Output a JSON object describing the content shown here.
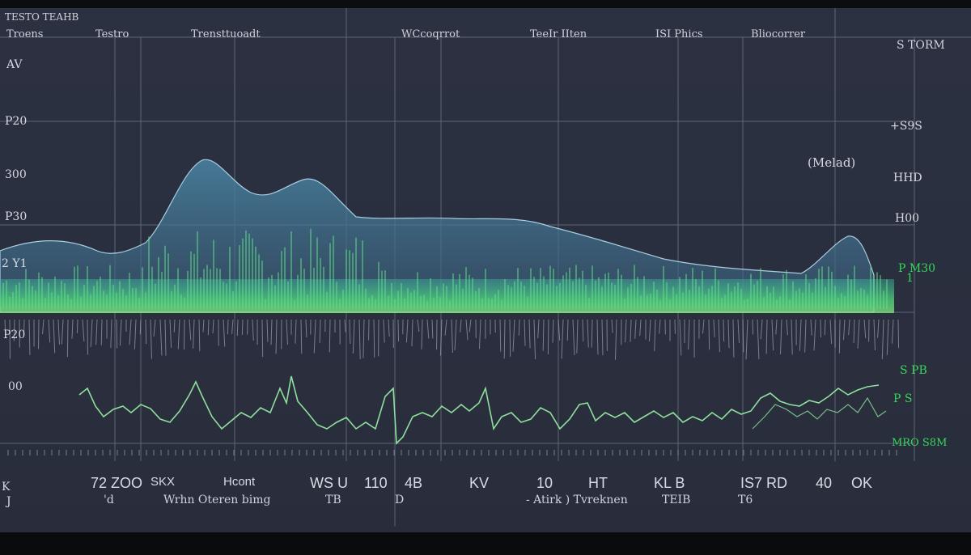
{
  "header": {
    "title": "TESTO TEAHB",
    "items": [
      "Troens",
      "Testro",
      "Trensttuoadt",
      "WCcoqrrot",
      "TeeIr IIten",
      "ISI  Phics",
      "Bliocorrer"
    ]
  },
  "right_header": "S TORM",
  "left_axis": [
    "AV",
    "P20",
    "300",
    "P30",
    "2 Y1",
    "P20",
    "00",
    "K",
    "J"
  ],
  "right_axis": [
    "+S9S",
    "HHD",
    "H00",
    "P M30",
    "1",
    "S PB",
    "P S",
    "MRO S8M"
  ],
  "annotation": "(Melad)",
  "bottom_row1": [
    "72 ZOO",
    "SKX",
    "Hcont",
    "WS U",
    "110",
    "4B",
    "KV",
    "10",
    "HT",
    "KL B",
    "IS7 RD",
    "40",
    "OK"
  ],
  "bottom_row2": [
    "'d",
    "Wrhn  Oteren bimg",
    "TB",
    "D",
    "- Atirk )  Tvreknen",
    "TEIB",
    "T6"
  ],
  "colors": {
    "screen_bg": "#2b3041",
    "grid": "#8a91a3",
    "mountain": "#3f6f8a",
    "spectrum": "#43d37a",
    "trace": "#8fe09c",
    "accent_green": "#37d65b"
  }
}
